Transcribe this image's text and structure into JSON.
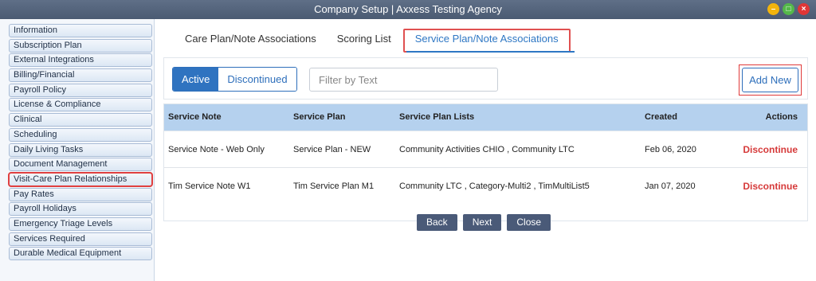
{
  "window": {
    "title": "Company Setup | Axxess Testing Agency",
    "controls": [
      "minimize-icon",
      "maximize-icon",
      "close-icon"
    ]
  },
  "sidebar": {
    "items": [
      {
        "label": "Information"
      },
      {
        "label": "Subscription Plan"
      },
      {
        "label": "External Integrations"
      },
      {
        "label": "Billing/Financial"
      },
      {
        "label": "Payroll Policy"
      },
      {
        "label": "License & Compliance"
      },
      {
        "label": "Clinical"
      },
      {
        "label": "Scheduling"
      },
      {
        "label": "Daily Living Tasks"
      },
      {
        "label": "Document Management"
      },
      {
        "label": "Visit-Care Plan Relationships"
      },
      {
        "label": "Pay Rates"
      },
      {
        "label": "Payroll Holidays"
      },
      {
        "label": "Emergency Triage Levels"
      },
      {
        "label": "Services Required"
      },
      {
        "label": "Durable Medical Equipment"
      }
    ],
    "highlighted_index": 10
  },
  "tabs": [
    {
      "label": "Care Plan/Note Associations"
    },
    {
      "label": "Scoring List"
    },
    {
      "label": "Service Plan/Note Associations"
    }
  ],
  "active_tab_index": 2,
  "filter_bar": {
    "segments": [
      {
        "label": "Active"
      },
      {
        "label": "Discontinued"
      }
    ],
    "active_segment": 0,
    "filter_placeholder": "Filter by Text",
    "filter_value": "",
    "add_new_label": "Add New"
  },
  "table": {
    "headers": {
      "service_note": "Service Note",
      "service_plan": "Service Plan",
      "service_plan_lists": "Service Plan Lists",
      "created": "Created",
      "actions": "Actions"
    },
    "rows": [
      {
        "service_note": "Service Note - Web Only",
        "service_plan": "Service Plan - NEW",
        "service_plan_lists": "Community Activities CHIO , Community LTC",
        "created": "Feb 06, 2020",
        "action": "Discontinue"
      },
      {
        "service_note": "Tim Service Note W1",
        "service_plan": "Tim Service Plan M1",
        "service_plan_lists": "Community LTC , Category-Multi2 , TimMultiList5",
        "created": "Jan 07, 2020",
        "action": "Discontinue"
      }
    ]
  },
  "footer": {
    "back_label": "Back",
    "next_label": "Next",
    "close_label": "Close"
  },
  "colors": {
    "accent": "#2e77c4",
    "highlight_border": "#e04040",
    "action_text": "#d63a3a",
    "table_header_bg": "#b5d1ee",
    "footer_button_bg": "#4a5a78"
  }
}
